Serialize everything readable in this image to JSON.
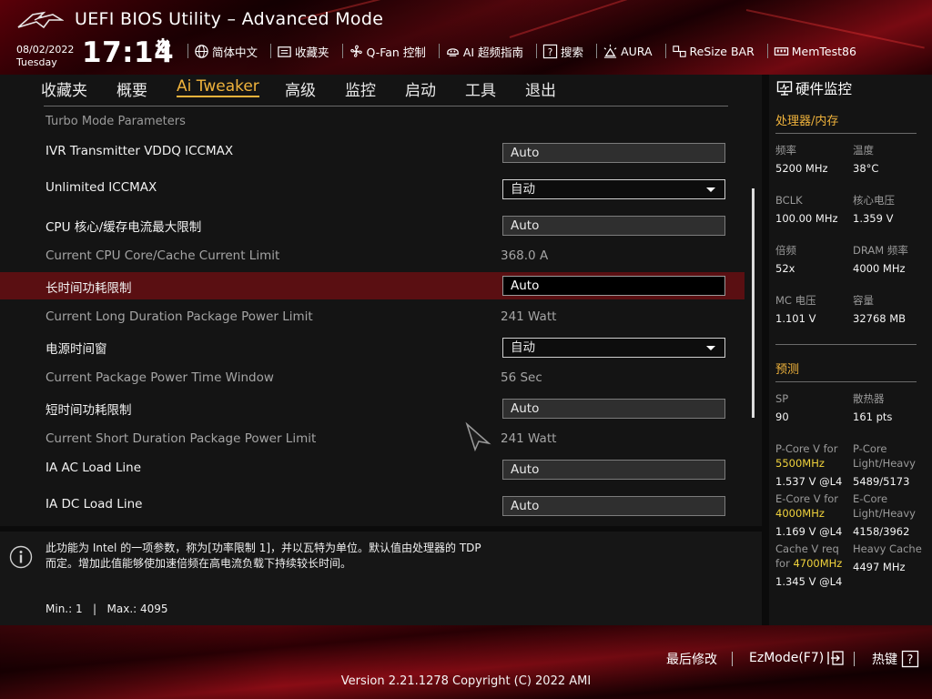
{
  "header": {
    "app_title": "UEFI BIOS Utility – Advanced Mode",
    "date": "08/02/2022",
    "day": "Tuesday",
    "time": "17:14",
    "toolbar": [
      {
        "name": "language-button",
        "icon": "globe-icon",
        "label": "简体中文"
      },
      {
        "name": "favorites-button",
        "icon": "favorites-folder-icon",
        "label": "收藏夹"
      },
      {
        "name": "qfan-button",
        "icon": "fan-icon",
        "label": "Q-Fan 控制"
      },
      {
        "name": "ai-oc-guide-button",
        "icon": "ai-chip-icon",
        "label": "AI 超频指南"
      },
      {
        "name": "search-button",
        "icon": "search-help-icon",
        "label": "搜索"
      },
      {
        "name": "aura-button",
        "icon": "aura-light-icon",
        "label": "AURA"
      },
      {
        "name": "resize-bar-button",
        "icon": "resize-bar-icon",
        "label": "ReSize BAR"
      },
      {
        "name": "memtest-button",
        "icon": "memory-icon",
        "label": "MemTest86"
      }
    ]
  },
  "menu": {
    "tabs": [
      "收藏夹",
      "概要",
      "Ai Tweaker",
      "高级",
      "监控",
      "启动",
      "工具",
      "退出"
    ],
    "active_index": 2
  },
  "settings": {
    "section_label": "Turbo Mode Parameters",
    "rows": [
      {
        "label": "IVR Transmitter VDDQ ICCMAX",
        "type": "input",
        "value": "Auto"
      },
      {
        "label": "Unlimited ICCMAX",
        "type": "select",
        "value": "自动"
      },
      {
        "label": "CPU 核心/缓存电流最大限制",
        "type": "input",
        "value": "Auto"
      },
      {
        "label": "Current CPU Core/Cache Current Limit",
        "type": "info",
        "value": "368.0 A"
      },
      {
        "label": "长时间功耗限制",
        "type": "input-selected",
        "value": "Auto"
      },
      {
        "label": "Current Long Duration Package Power Limit",
        "type": "info",
        "value": "241 Watt"
      },
      {
        "label": "电源时间窗",
        "type": "select",
        "value": "自动"
      },
      {
        "label": "Current Package Power Time Window",
        "type": "info",
        "value": "56 Sec"
      },
      {
        "label": "短时间功耗限制",
        "type": "input",
        "value": "Auto"
      },
      {
        "label": "Current Short Duration Package Power Limit",
        "type": "info",
        "value": "241 Watt"
      },
      {
        "label": "IA AC Load Line",
        "type": "input",
        "value": "Auto"
      },
      {
        "label": "IA DC Load Line",
        "type": "input",
        "value": "Auto"
      }
    ]
  },
  "help": {
    "line1": "此功能为 Intel 的一项参数，称为[功率限制 1]，并以瓦特为单位。默认值由处理器的 TDP",
    "line2": "而定。增加此值能够使加速倍频在高电流负载下持续较长时间。",
    "min_max": "Min.: 1   |   Max.: 4095"
  },
  "hardware_monitor": {
    "title": "硬件监控",
    "cpu_mem_title": "处理器/内存",
    "cpu_mem": [
      {
        "k1": "频率",
        "v1": "5200 MHz",
        "k2": "温度",
        "v2": "38°C"
      },
      {
        "k1": "BCLK",
        "v1": "100.00 MHz",
        "k2": "核心电压",
        "v2": "1.359 V"
      },
      {
        "k1": "倍频",
        "v1": "52x",
        "k2": "DRAM 频率",
        "v2": "4000 MHz"
      },
      {
        "k1": "MC 电压",
        "v1": "1.101 V",
        "k2": "容量",
        "v2": "32768 MB"
      }
    ],
    "prediction_title": "预测",
    "sp_label": "SP",
    "sp_value": "90",
    "cooler_label": "散热器",
    "cooler_value": "161 pts",
    "pcore_for": "P-Core V for",
    "pcore_freq": "5500MHz",
    "pcore_v": "1.537 V @L4",
    "pcore_lh_label1": "P-Core",
    "pcore_lh_label2": "Light/Heavy",
    "pcore_lh_value": "5489/5173",
    "ecore_for": "E-Core V for",
    "ecore_freq": "4000MHz",
    "ecore_v": "1.169 V @L4",
    "ecore_lh_label1": "E-Core",
    "ecore_lh_label2": "Light/Heavy",
    "ecore_lh_value": "4158/3962",
    "cache_for1": "Cache V req",
    "cache_for2": "for",
    "cache_freq": "4700MHz",
    "cache_v": "1.345 V @L4",
    "heavy_cache_label": "Heavy Cache",
    "heavy_cache_value": "4497 MHz"
  },
  "footer": {
    "last_modified": "最后修改",
    "ezmode": "EzMode(F7)",
    "hotkeys": "热键",
    "version": "Version 2.21.1278 Copyright (C) 2022 AMI"
  },
  "colors": {
    "accent": "#f0b33c",
    "highlight_row": "#5a0f12",
    "brand_red": "#8a0c15"
  }
}
